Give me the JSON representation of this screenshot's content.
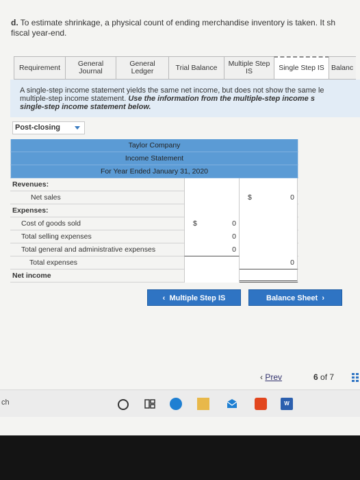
{
  "question": {
    "part": "d.",
    "text": " To estimate shrinkage, a physical count of ending merchandise inventory is taken. It sh",
    "line2": "fiscal year-end."
  },
  "tabs": [
    {
      "label": "Requirement"
    },
    {
      "label": "General Journal"
    },
    {
      "label": "General Ledger"
    },
    {
      "label": "Trial Balance"
    },
    {
      "label": "Multiple Step IS"
    },
    {
      "label": "Single Step IS"
    },
    {
      "label": "Balanc"
    }
  ],
  "instructions": {
    "line1": "A single-step income statement yields the same net income, but does not show the same le",
    "line2a": "multiple-step income statement. ",
    "line2b": "Use the information from the multiple-step income s",
    "line3": "single-step income statement below."
  },
  "dropdown": {
    "selected": "Post-closing"
  },
  "statement": {
    "company": "Taylor Company",
    "title": "Income Statement",
    "period": "For Year Ended January 31, 2020",
    "revenues_label": "Revenues:",
    "net_sales_label": "Net sales",
    "net_sales_currency": "$",
    "net_sales_value": "0",
    "expenses_label": "Expenses:",
    "cogs_label": "Cost of goods sold",
    "cogs_currency": "$",
    "cogs_value": "0",
    "selling_label": "Total selling expenses",
    "selling_value": "0",
    "ga_label": "Total general and administrative expenses",
    "ga_value": "0",
    "total_exp_label": "Total expenses",
    "total_exp_value": "0",
    "net_income_label": "Net income"
  },
  "nav": {
    "prev_button": "Multiple Step IS",
    "next_button": "Balance Sheet",
    "prev_link": "Prev",
    "page_current": "6",
    "page_of": "of",
    "page_total": "7"
  },
  "taskbar": {
    "search_label": "ch",
    "word_letter": "W"
  }
}
